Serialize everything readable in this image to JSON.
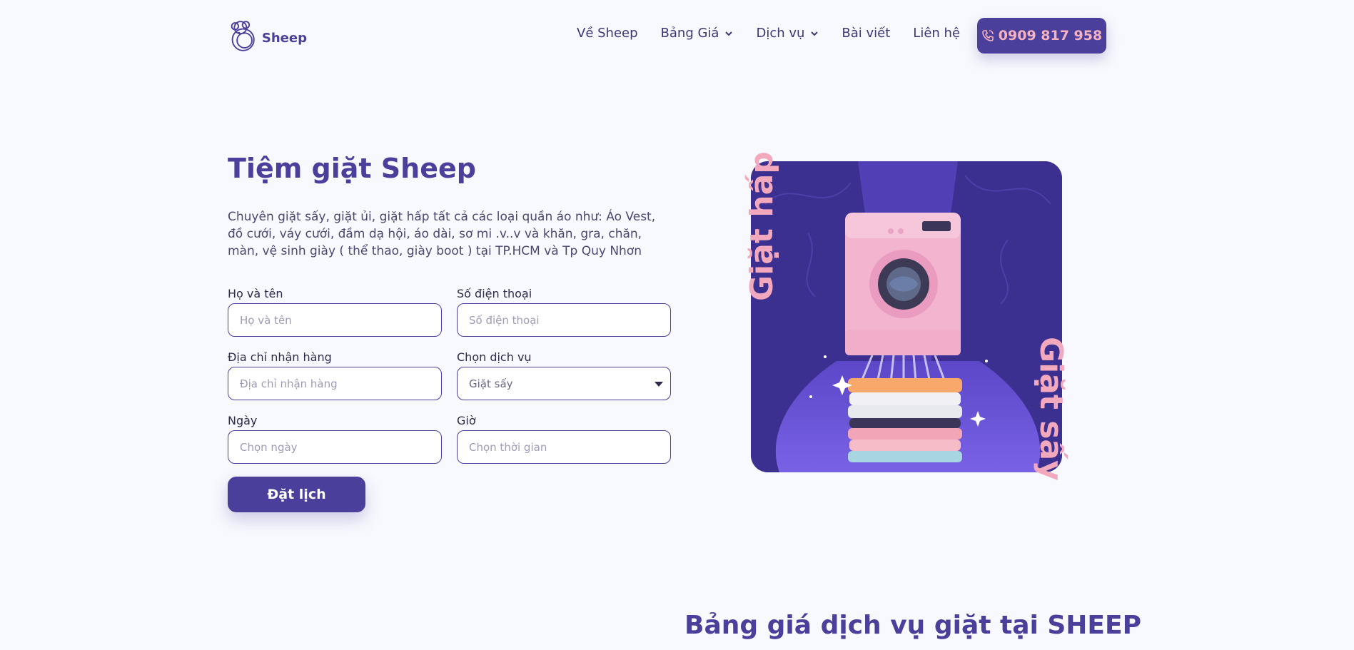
{
  "brand": {
    "name": "Sheep"
  },
  "nav": {
    "items": [
      {
        "label": "Về Sheep",
        "dropdown": false
      },
      {
        "label": "Bảng Giá",
        "dropdown": true
      },
      {
        "label": "Dịch vụ",
        "dropdown": true
      },
      {
        "label": "Bài viết",
        "dropdown": false
      },
      {
        "label": "Liên hệ",
        "dropdown": false
      }
    ],
    "phone": "0909 817 958"
  },
  "hero": {
    "title": "Tiệm giặt Sheep",
    "description": "Chuyên giặt sấy, giặt ủi, giặt hấp tất cả các loại  quần áo như: Áo Vest, đồ cưới, váy cưới, đầm dạ hội, áo dài, sơ mi .v..v và khăn, gra, chăn, màn, vệ sinh giày ( thể thao, giày boot ) tại TP.HCM và Tp Quy Nhơn"
  },
  "form": {
    "name": {
      "label": "Họ và tên",
      "placeholder": "Họ và tên"
    },
    "phone": {
      "label": "Số điện thoại",
      "placeholder": "Số điện thoại"
    },
    "address": {
      "label": "Địa chỉ nhận hàng",
      "placeholder": "Địa chỉ nhận hàng"
    },
    "service": {
      "label": "Chọn dịch vụ",
      "value": "Giặt sấy"
    },
    "date": {
      "label": "Ngày",
      "placeholder": "Chọn ngày"
    },
    "time": {
      "label": "Giờ",
      "placeholder": "Chọn thời gian"
    },
    "submit": "Đặt lịch"
  },
  "illustration": {
    "text_left": "Giặt hấp",
    "text_right": "Giặt sấy"
  },
  "pricing": {
    "title": "Bảng giá dịch vụ giặt tại SHEEP"
  },
  "colors": {
    "primary": "#4a3f9a",
    "accent": "#f3a9bd",
    "background": "#f8f9fe"
  }
}
